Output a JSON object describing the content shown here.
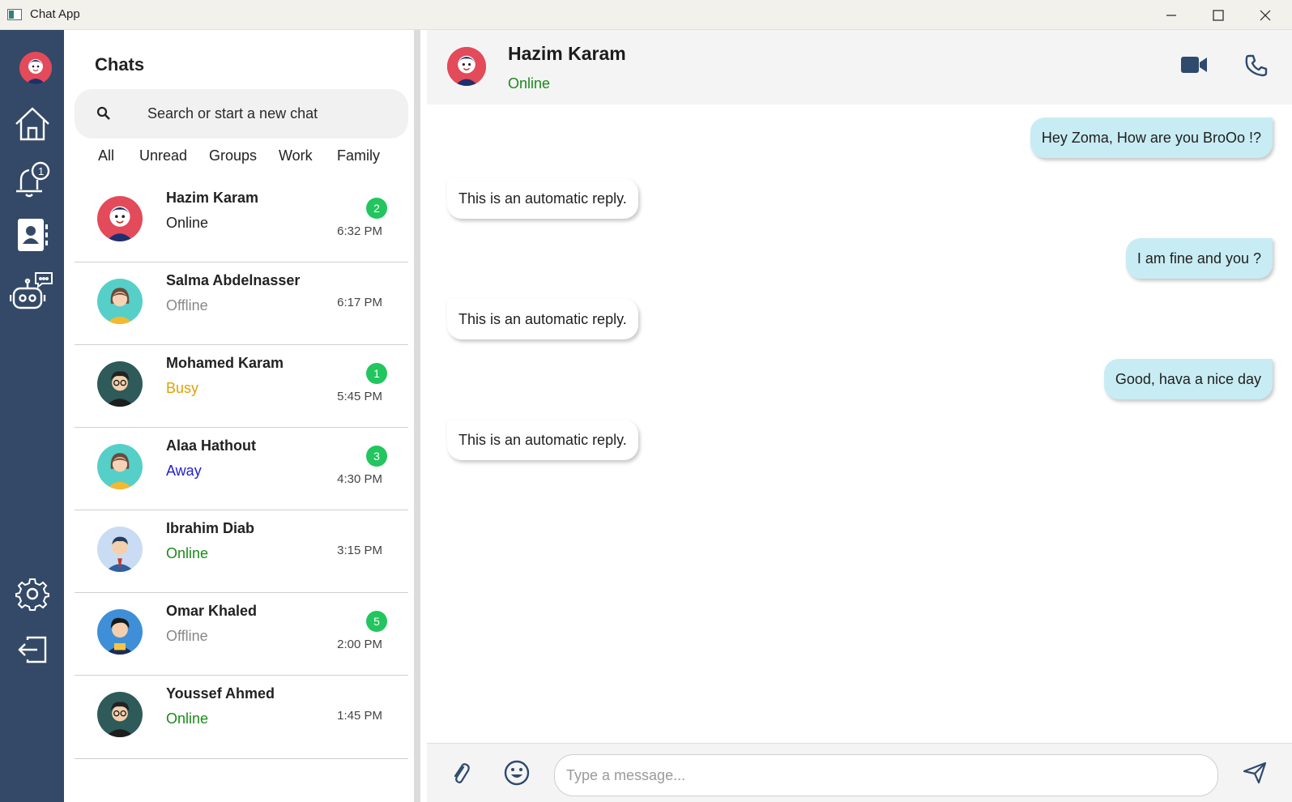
{
  "window": {
    "title": "Chat App"
  },
  "rail": {
    "items": [
      "profile-avatar",
      "home-icon",
      "notifications-icon",
      "contacts-icon",
      "chatbot-icon",
      "settings-icon",
      "logout-icon"
    ],
    "notification_count": "1"
  },
  "chat_list": {
    "title": "Chats",
    "search_placeholder": "Search or start a new chat",
    "filters": [
      "All",
      "Unread",
      "Groups",
      "Work",
      "Family"
    ],
    "contacts": [
      {
        "name": "Hazim Karam",
        "status": "Online",
        "status_color": "#222222",
        "time": "6:32 PM",
        "badge": "2",
        "avatar": "boy-red"
      },
      {
        "name": "Salma Abdelnasser",
        "status": "Offline",
        "status_color": "#888888",
        "time": "6:17 PM",
        "badge": "",
        "avatar": "woman-teal"
      },
      {
        "name": "Mohamed Karam",
        "status": "Busy",
        "status_color": "#e0a100",
        "time": "5:45 PM",
        "badge": "1",
        "avatar": "man-glasses"
      },
      {
        "name": "Alaa Hathout",
        "status": "Away",
        "status_color": "#2222cc",
        "time": "4:30 PM",
        "badge": "3",
        "avatar": "woman-teal"
      },
      {
        "name": "Ibrahim Diab",
        "status": "Online",
        "status_color": "#1a8a1a",
        "time": "3:15 PM",
        "badge": "",
        "avatar": "man-suit"
      },
      {
        "name": "Omar Khaled",
        "status": "Offline",
        "status_color": "#888888",
        "time": "2:00 PM",
        "badge": "5",
        "avatar": "man-blue"
      },
      {
        "name": "Youssef Ahmed",
        "status": "Online",
        "status_color": "#1a8a1a",
        "time": "1:45 PM",
        "badge": "",
        "avatar": "man-glasses"
      }
    ]
  },
  "conversation": {
    "contact_name": "Hazim Karam",
    "contact_status": "Online",
    "messages": [
      {
        "direction": "out",
        "text": "Hey Zoma, How are you BroOo !?"
      },
      {
        "direction": "in",
        "text": "This is an automatic reply."
      },
      {
        "direction": "out",
        "text": "I am fine and you ?"
      },
      {
        "direction": "in",
        "text": "This is an automatic reply."
      },
      {
        "direction": "out",
        "text": "Good, hava a nice day"
      },
      {
        "direction": "in",
        "text": "This is an automatic reply."
      }
    ],
    "composer_placeholder": "Type a message..."
  },
  "colors": {
    "rail": "#344967",
    "badge": "#22c55e",
    "outgoing_bubble": "#c8ecf3",
    "online": "#1a8a1a"
  }
}
